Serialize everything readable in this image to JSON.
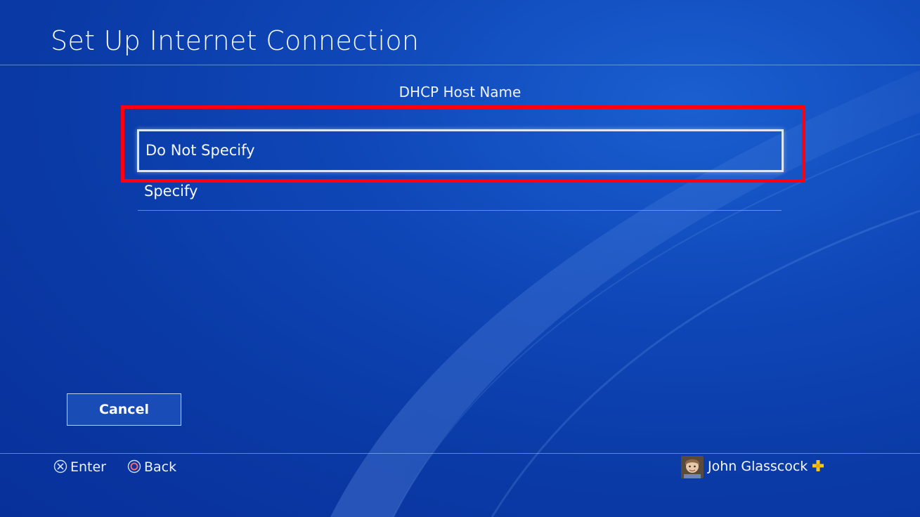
{
  "header": {
    "title": "Set Up Internet Connection"
  },
  "dialog": {
    "subtitle": "DHCP Host Name",
    "options": [
      {
        "label": "Do Not Specify",
        "selected": true
      },
      {
        "label": "Specify",
        "selected": false
      }
    ],
    "cancel_label": "Cancel"
  },
  "footer": {
    "enter_label": "Enter",
    "back_label": "Back",
    "enter_icon": "cross-button-icon",
    "back_icon": "circle-button-icon",
    "user_name": "John Glasscock",
    "plus_icon": "playstation-plus-icon"
  },
  "colors": {
    "background": "#0a3aa6",
    "highlight_frame": "#ff0010",
    "plus_badge": "#f5c518"
  }
}
